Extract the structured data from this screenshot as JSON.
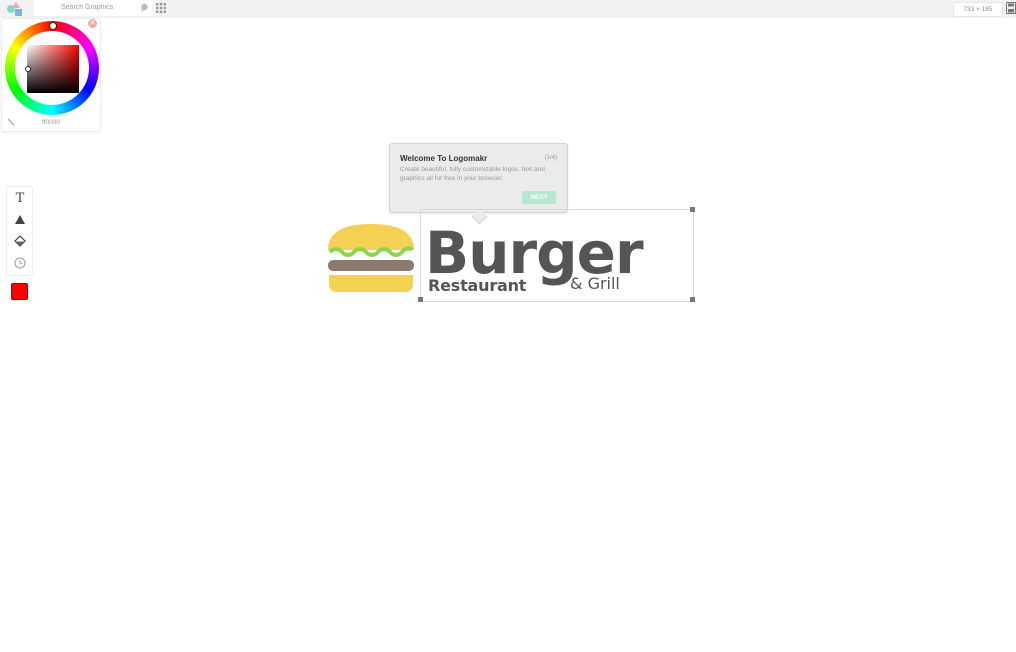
{
  "app": {
    "name": "Logomakr",
    "icon": "logomakr-logo-icon"
  },
  "search": {
    "placeholder": "Search Graphics",
    "value": "",
    "icon": "search-icon",
    "grid_icon": "grid-view-icon"
  },
  "canvas_size": {
    "text": "733 × 185"
  },
  "color_picker": {
    "hex": "ff0000",
    "selected_color": "#ff0000",
    "close_icon": "close-icon",
    "eyedropper_icon": "eyedropper-icon"
  },
  "tools": [
    {
      "name": "text-tool",
      "label": "T"
    },
    {
      "name": "shape-tool",
      "icon": "triangle-icon"
    },
    {
      "name": "fill-tool",
      "icon": "fill-bucket-icon"
    },
    {
      "name": "history-tool",
      "icon": "history-icon"
    }
  ],
  "current_swatch": "#ff0000",
  "tour": {
    "title": "Welcome To Logomakr",
    "step": "(1/4)",
    "body": "Create beautiful, fully customizable logos, text and graphics all for free in your browser.",
    "next_label": "NEXT"
  },
  "logo": {
    "headline": "Burger",
    "subline": "Restaurant",
    "subline2": "& Grill",
    "colors": {
      "bun": "#f3d152",
      "lettuce": "#8fd44b",
      "patty": "#8a7b6e",
      "text": "#555555"
    }
  }
}
